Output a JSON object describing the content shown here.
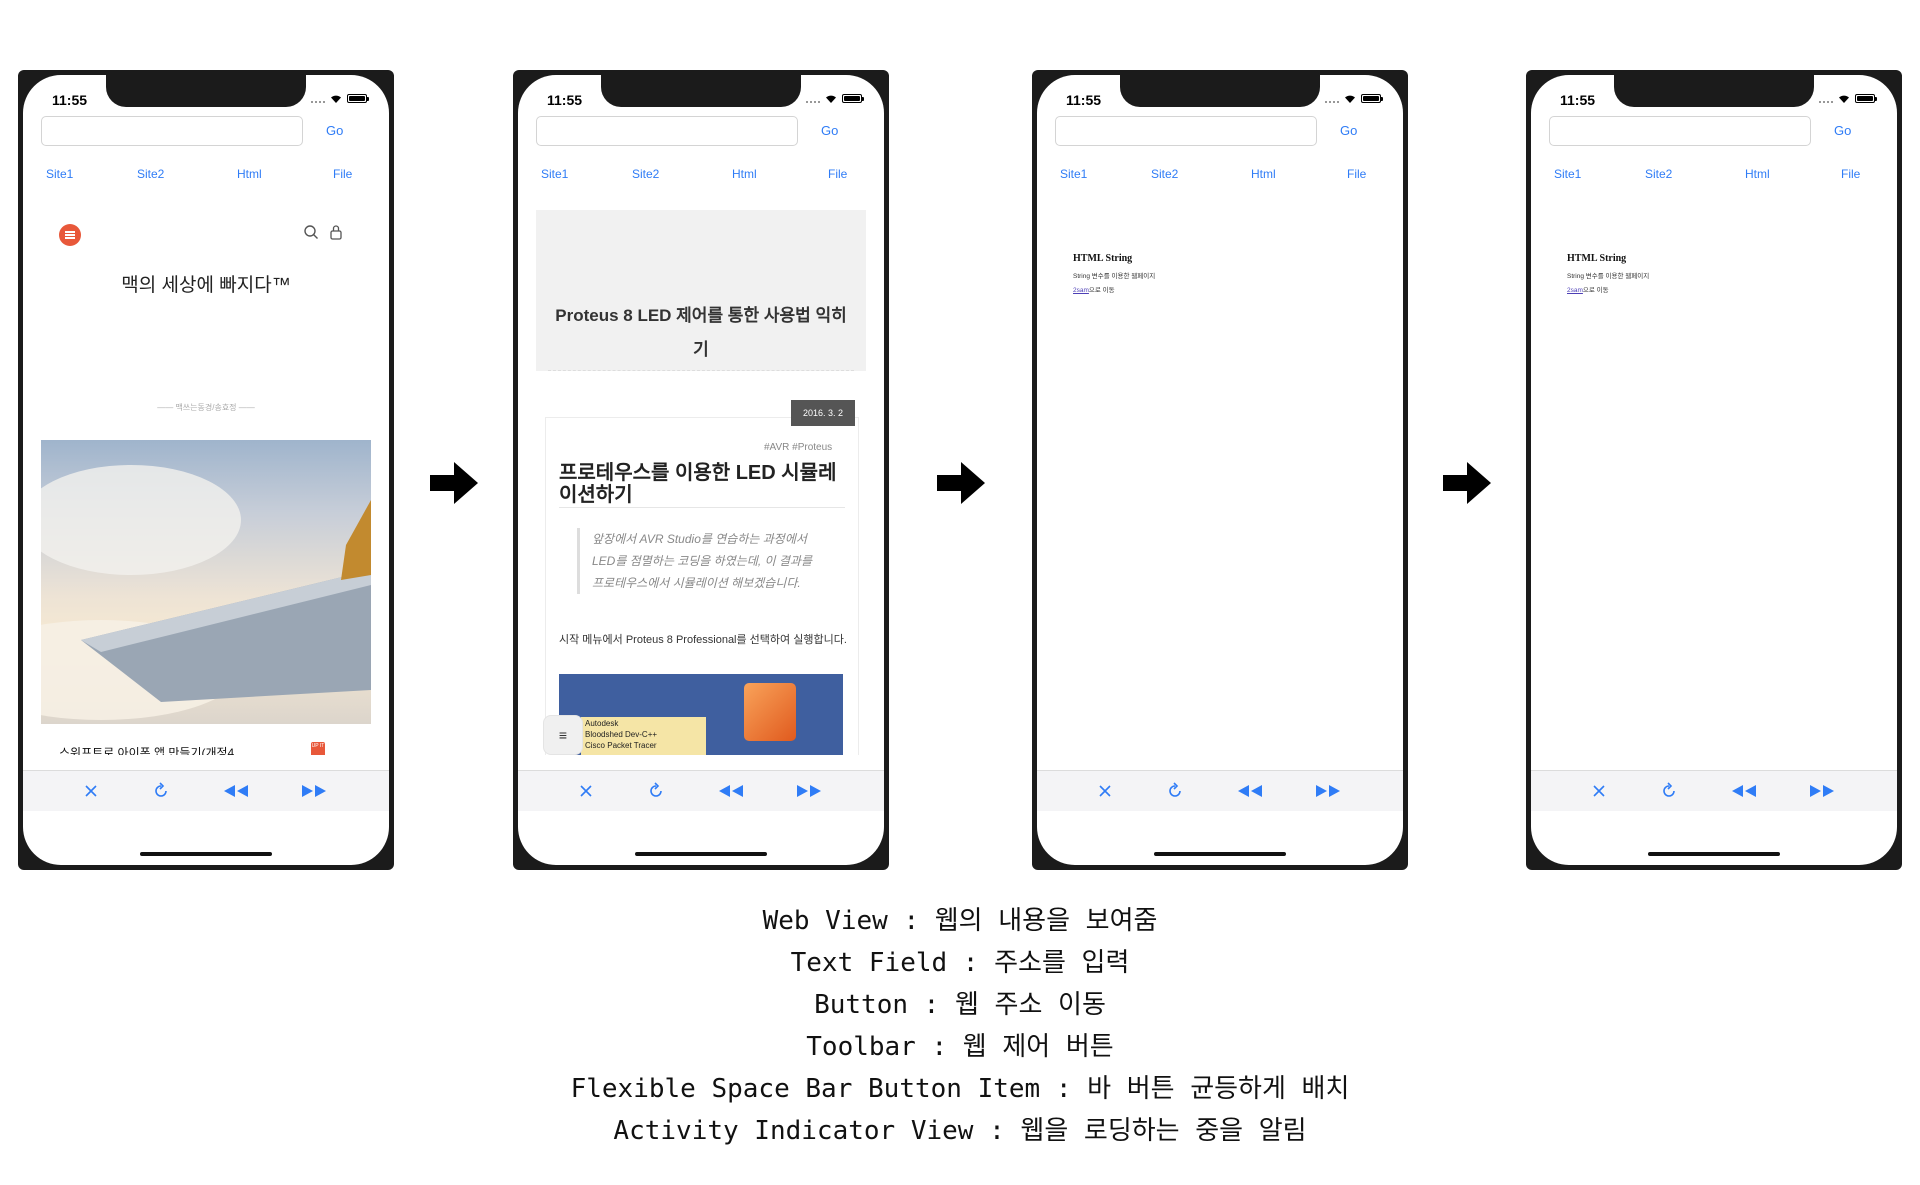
{
  "status_bar": {
    "time": "11:55"
  },
  "nav": {
    "go_label": "Go",
    "sites": [
      "Site1",
      "Site2",
      "Html",
      "File"
    ]
  },
  "toolbar": {
    "stop_icon": "close-icon",
    "reload_icon": "reload-icon",
    "back_icon": "rewind-icon",
    "forward_icon": "fast-forward-icon"
  },
  "accent_color": "#2f7cf6",
  "screens": [
    {
      "blog_title": "맥의 세상에 빠지다™",
      "blog_subtitle": "맥쓰는동경/송효정",
      "post_title": "스위프트로 아이폰 앱 만들기(개정4",
      "mini_logo": "UP IT"
    },
    {
      "header_title": "Proteus 8 LED 제어를 통한 사용법 익히기",
      "date": "2016. 3. 2",
      "tags": "#AVR   #Proteus",
      "post_title": "프로테우스를 이용한 LED 시뮬레이션하기",
      "quote": "앞장에서 AVR Studio를 연습하는 과정에서 LED를 점멸하는 코딩을 하였는데, 이 결과를 프로테우스에서 시뮬레이션 해보겠습니다.",
      "body": "시작 메뉴에서 Proteus 8 Professional를 선택하여 실행합니다.",
      "menu_items": [
        "Autodesk",
        "Bloodshed Dev-C++",
        "Cisco Packet Tracer"
      ]
    },
    {
      "title": "HTML String",
      "line": "String 변수를 이용한 웹페이지",
      "link_text": "2sam",
      "link_suffix": "으로 이동"
    },
    {
      "title": "HTML String",
      "line": "String 변수를 이용한 웹페이지",
      "link_text": "2sam",
      "link_suffix": "으로 이동"
    }
  ],
  "captions": [
    "Web View : 웹의 내용을 보여줌",
    "Text Field : 주소를 입력",
    "Button : 웹 주소 이동",
    "Toolbar : 웹 제어 버튼",
    "Flexible Space Bar Button Item : 바 버튼 균등하게 배치",
    "Activity Indicator View : 웹을 로딩하는 중을 알림"
  ]
}
